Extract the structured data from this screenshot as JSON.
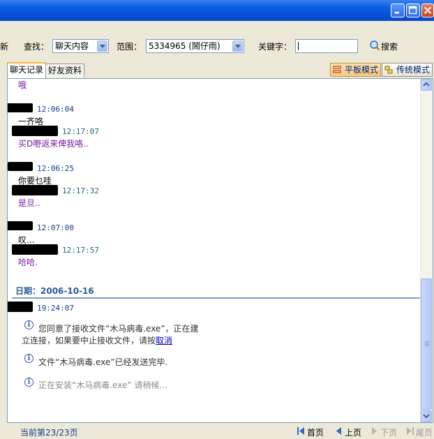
{
  "window": {
    "buttons": [
      "minimize",
      "maximize",
      "close"
    ]
  },
  "toolbar": {
    "refresh_label": "新",
    "find_label": "查找：",
    "find_value": "聊天内容",
    "range_label": "范围：",
    "range_value": "5334965 (鬧仔雨)",
    "keyword_label": "关键字：",
    "keyword_value": "",
    "search_label": "搜索"
  },
  "tabs": [
    {
      "label": "聊天记录",
      "active": true
    },
    {
      "label": "好友资料",
      "active": false
    }
  ],
  "modes": [
    {
      "label": "平板模式",
      "active": true
    },
    {
      "label": "传统模式",
      "active": false
    }
  ],
  "messages": [
    {
      "text": "哦"
    },
    {
      "time": "12:06:04",
      "text": "一齐咯"
    },
    {
      "time": "12:17:07",
      "text": "买D嘢返来俾我咯.."
    },
    {
      "time": "12:06:25",
      "text": "你要乜哇"
    },
    {
      "time": "12:17:32",
      "text": "是旦.."
    },
    {
      "time": "12:07:00",
      "text": "叹..."
    },
    {
      "time": "12:17:57",
      "text": "哈哈."
    }
  ],
  "date_header": "日期：2006-10-16",
  "last_time": "19:24:07",
  "system_msgs": {
    "accept_line1": "您同意了接收文件“木马病毒.exe”，正在建",
    "accept_line2": "立连接，如果要中止接收文件，请按",
    "cancel_link": "取消",
    "sent": "文件“木马病毒.exe”已经发送完毕.",
    "installing": "正在安装“木马病毒.exe”  请稍候..."
  },
  "status": {
    "page": "当前第23/23页",
    "first": "首页",
    "prev": "上页",
    "next": "下页",
    "last": "尾页"
  }
}
